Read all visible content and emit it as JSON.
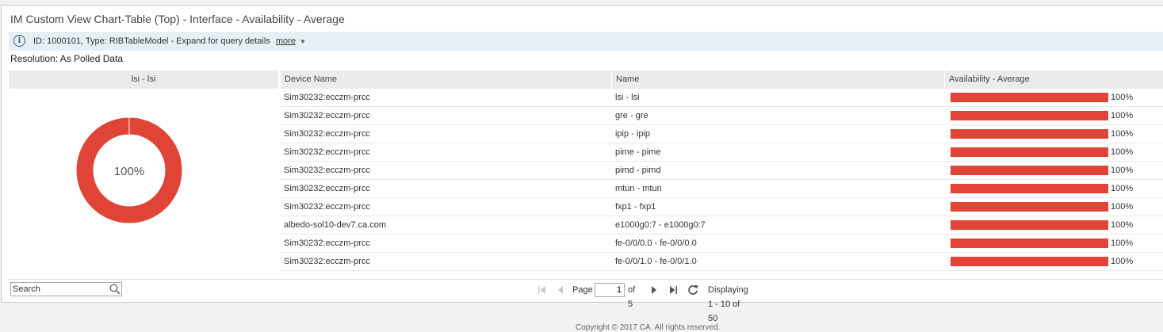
{
  "title": "IM Custom View Chart-Table (Top) - Interface - Availability - Average",
  "info": {
    "text": "ID: 1000101, Type: RIBTableModel - Expand for query details",
    "more": "more"
  },
  "resolution": "Resolution: As Polled Data",
  "chart": {
    "header": "lsi - lsi",
    "center_label": "100%",
    "color": "#e04436"
  },
  "table": {
    "columns": [
      "Device Name",
      "Name",
      "Availability - Average"
    ],
    "rows": [
      {
        "device": "Sim30232:ecczm-prcc",
        "name": "lsi - lsi",
        "availability": 100,
        "label": "100%"
      },
      {
        "device": "Sim30232:ecczm-prcc",
        "name": "gre - gre",
        "availability": 100,
        "label": "100%"
      },
      {
        "device": "Sim30232:ecczm-prcc",
        "name": "ipip - ipip",
        "availability": 100,
        "label": "100%"
      },
      {
        "device": "Sim30232:ecczm-prcc",
        "name": "pime - pime",
        "availability": 100,
        "label": "100%"
      },
      {
        "device": "Sim30232:ecczm-prcc",
        "name": "pimd - pimd",
        "availability": 100,
        "label": "100%"
      },
      {
        "device": "Sim30232:ecczm-prcc",
        "name": "mtun - mtun",
        "availability": 100,
        "label": "100%"
      },
      {
        "device": "Sim30232:ecczm-prcc",
        "name": "fxp1 - fxp1",
        "availability": 100,
        "label": "100%"
      },
      {
        "device": "albedo-sol10-dev7.ca.com",
        "name": "e1000g0:7 - e1000g0:7",
        "availability": 100,
        "label": "100%"
      },
      {
        "device": "Sim30232:ecczm-prcc",
        "name": "fe-0/0/0.0 - fe-0/0/0.0",
        "availability": 100,
        "label": "100%"
      },
      {
        "device": "Sim30232:ecczm-prcc",
        "name": "fe-0/0/1.0 - fe-0/0/1.0",
        "availability": 100,
        "label": "100%"
      }
    ],
    "bar_color": "#e04436"
  },
  "search": {
    "placeholder": "Search"
  },
  "pager": {
    "page_label": "Page",
    "page_value": "1",
    "of_label": "of 5",
    "display": "Displaying 1 - 10 of 50"
  },
  "copyright": "Copyright © 2017 CA. All rights reserved."
}
